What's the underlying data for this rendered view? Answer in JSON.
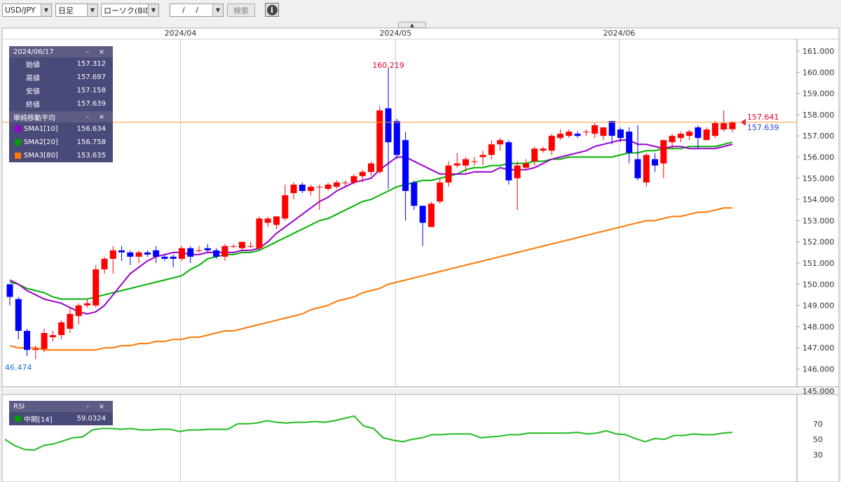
{
  "toolbar": {
    "pair": "USD/JPY",
    "timeframe": "日足",
    "chart_kind": "ローソク(BID)",
    "date": "/ /",
    "search": "検索",
    "info": "i"
  },
  "ohlc_panel": {
    "date": "2024/06/17",
    "rows": [
      {
        "label": "始値",
        "value": "157.312"
      },
      {
        "label": "高値",
        "value": "157.697"
      },
      {
        "label": "安値",
        "value": "157.158"
      },
      {
        "label": "終値",
        "value": "157.639"
      }
    ]
  },
  "sma_panel": {
    "title": "単純移動平均",
    "rows": [
      {
        "label": "SMA1[10]",
        "value": "156.634",
        "color": "#9900cc"
      },
      {
        "label": "SMA2[20]",
        "value": "156.758",
        "color": "#00a000"
      },
      {
        "label": "SMA3[80]",
        "value": "153.635",
        "color": "#ff7700"
      }
    ]
  },
  "rsi_panel": {
    "title": "RSI",
    "rows": [
      {
        "label": "中期[14]",
        "value": "59.0324",
        "color": "#00a000"
      }
    ]
  },
  "panel_buttons": {
    "minimize": "-",
    "close": "×"
  },
  "annotations": {
    "high_label": "160.219",
    "low_label": "46.474",
    "last_price": "157.641",
    "last_price2": "157.639"
  },
  "colors": {
    "up": "#ff0000",
    "down": "#0000ff",
    "sma1": "#9900cc",
    "sma2": "#00b000",
    "sma3": "#ff7700",
    "rsi": "#22bb22",
    "price_line": "#ff9933"
  },
  "chart_data": [
    {
      "type": "candlestick",
      "x_labels": [
        "2024/04",
        "2024/05",
        "2024/06"
      ],
      "ylim": [
        145.5,
        161.5
      ],
      "yticks": [
        "161.000",
        "160.000",
        "159.000",
        "158.000",
        "157.000",
        "156.000",
        "155.000",
        "154.000",
        "153.000",
        "152.000",
        "151.000",
        "150.000",
        "149.000",
        "148.000",
        "147.000",
        "146.000"
      ],
      "ohlc": [
        [
          150.0,
          150.0,
          149.0,
          149.4
        ],
        [
          149.3,
          149.4,
          147.4,
          147.8
        ],
        [
          147.8,
          147.9,
          146.6,
          146.9
        ],
        [
          146.9,
          147.1,
          146.47,
          146.95
        ],
        [
          146.95,
          147.9,
          146.8,
          147.7
        ],
        [
          147.5,
          147.8,
          147.3,
          147.6
        ],
        [
          147.6,
          148.3,
          147.4,
          148.2
        ],
        [
          147.9,
          148.9,
          147.7,
          148.6
        ],
        [
          148.5,
          149.1,
          148.1,
          149.0
        ],
        [
          149.0,
          149.3,
          148.9,
          149.1
        ],
        [
          149.0,
          150.9,
          148.9,
          150.7
        ],
        [
          150.7,
          151.3,
          150.5,
          151.2
        ],
        [
          151.2,
          151.8,
          150.5,
          151.6
        ],
        [
          151.6,
          151.8,
          151.1,
          151.5
        ],
        [
          151.5,
          151.6,
          150.9,
          151.3
        ],
        [
          151.3,
          151.6,
          151.0,
          151.5
        ],
        [
          151.5,
          151.6,
          151.3,
          151.4
        ],
        [
          151.6,
          151.8,
          151.0,
          151.3
        ],
        [
          151.3,
          151.4,
          151.1,
          151.2
        ],
        [
          151.3,
          151.4,
          150.8,
          151.2
        ],
        [
          151.2,
          151.8,
          151.1,
          151.7
        ],
        [
          151.7,
          151.8,
          151.0,
          151.3
        ],
        [
          151.6,
          151.8,
          151.5,
          151.6
        ],
        [
          151.7,
          151.9,
          151.5,
          151.6
        ],
        [
          151.6,
          151.7,
          151.2,
          151.3
        ],
        [
          151.3,
          151.9,
          151.1,
          151.8
        ],
        [
          151.8,
          151.9,
          151.7,
          151.8
        ],
        [
          151.7,
          152.0,
          151.6,
          152.0
        ],
        [
          151.8,
          152.0,
          151.7,
          151.8
        ],
        [
          151.7,
          153.2,
          151.6,
          153.1
        ],
        [
          152.9,
          153.2,
          152.7,
          153.1
        ],
        [
          152.8,
          153.2,
          152.6,
          153.2
        ],
        [
          153.1,
          154.7,
          153.0,
          154.2
        ],
        [
          154.3,
          154.8,
          154.0,
          154.7
        ],
        [
          154.7,
          154.8,
          154.3,
          154.4
        ],
        [
          154.4,
          154.7,
          154.2,
          154.6
        ],
        [
          154.6,
          154.7,
          153.5,
          154.6
        ],
        [
          154.5,
          154.8,
          154.4,
          154.7
        ],
        [
          154.6,
          154.9,
          154.5,
          154.8
        ],
        [
          154.8,
          154.9,
          154.6,
          154.8
        ],
        [
          154.8,
          155.2,
          154.7,
          155.1
        ],
        [
          155.1,
          155.4,
          154.8,
          155.3
        ],
        [
          155.3,
          155.8,
          155.1,
          155.7
        ],
        [
          155.3,
          158.4,
          155.2,
          158.2
        ],
        [
          158.3,
          160.2,
          154.5,
          156.7
        ],
        [
          157.7,
          157.8,
          155.9,
          156.1
        ],
        [
          156.8,
          157.2,
          153.0,
          154.4
        ],
        [
          154.8,
          154.9,
          153.5,
          153.7
        ],
        [
          153.7,
          153.7,
          151.8,
          152.9
        ],
        [
          152.7,
          153.9,
          152.7,
          153.8
        ],
        [
          153.9,
          155.0,
          153.8,
          154.8
        ],
        [
          154.8,
          155.8,
          154.6,
          155.6
        ],
        [
          155.6,
          156.2,
          155.5,
          155.7
        ],
        [
          155.6,
          156.0,
          155.3,
          155.9
        ],
        [
          155.8,
          156.0,
          155.6,
          155.8
        ],
        [
          156.0,
          156.3,
          155.6,
          156.1
        ],
        [
          156.1,
          156.8,
          155.9,
          156.6
        ],
        [
          156.6,
          156.9,
          156.3,
          156.8
        ],
        [
          156.7,
          156.8,
          154.7,
          154.9
        ],
        [
          155.0,
          155.8,
          153.5,
          155.6
        ],
        [
          155.5,
          155.9,
          155.4,
          155.7
        ],
        [
          155.8,
          156.5,
          155.6,
          156.4
        ],
        [
          156.3,
          156.5,
          156.2,
          156.4
        ],
        [
          156.3,
          157.1,
          156.1,
          157.0
        ],
        [
          156.9,
          157.3,
          156.8,
          157.1
        ],
        [
          157.0,
          157.3,
          156.9,
          157.2
        ],
        [
          157.1,
          157.2,
          156.9,
          157.0
        ],
        [
          157.2,
          157.3,
          157.0,
          157.2
        ],
        [
          157.1,
          157.6,
          156.9,
          157.5
        ],
        [
          157.0,
          157.3,
          156.8,
          157.4
        ],
        [
          157.7,
          157.7,
          156.6,
          157.0
        ],
        [
          157.3,
          157.4,
          156.7,
          156.9
        ],
        [
          157.2,
          157.4,
          155.7,
          156.2
        ],
        [
          155.9,
          157.5,
          154.9,
          155.0
        ],
        [
          154.8,
          156.2,
          154.6,
          156.1
        ],
        [
          155.9,
          156.2,
          155.3,
          155.6
        ],
        [
          155.7,
          156.8,
          155.0,
          156.8
        ],
        [
          156.7,
          157.1,
          156.4,
          157.0
        ],
        [
          156.9,
          157.2,
          156.7,
          157.1
        ],
        [
          157.0,
          157.3,
          156.8,
          157.2
        ],
        [
          157.4,
          157.5,
          156.4,
          156.9
        ],
        [
          156.8,
          157.4,
          156.8,
          157.3
        ],
        [
          157.0,
          157.7,
          156.9,
          157.6
        ],
        [
          157.3,
          158.2,
          157.2,
          157.6
        ],
        [
          157.312,
          157.697,
          157.158,
          157.639
        ]
      ],
      "sma1_10": [
        150.2,
        150.0,
        149.7,
        149.5,
        149.3,
        149.2,
        149.1,
        148.9,
        148.7,
        148.6,
        148.7,
        149.0,
        149.5,
        150.0,
        150.5,
        150.8,
        151.1,
        151.3,
        151.4,
        151.5,
        151.5,
        151.4,
        151.4,
        151.5,
        151.5,
        151.5,
        151.5,
        151.6,
        151.6,
        151.7,
        152.0,
        152.4,
        152.7,
        153.0,
        153.3,
        153.6,
        153.9,
        154.1,
        154.4,
        154.6,
        154.8,
        154.9,
        155.0,
        155.4,
        155.7,
        156.0,
        156.0,
        155.8,
        155.6,
        155.4,
        155.2,
        155.2,
        155.2,
        155.2,
        155.3,
        155.3,
        155.3,
        155.5,
        155.4,
        155.4,
        155.4,
        155.5,
        155.7,
        155.9,
        156.0,
        156.1,
        156.2,
        156.3,
        156.5,
        156.6,
        156.7,
        156.8,
        156.8,
        156.6,
        156.6,
        156.5,
        156.4,
        156.5,
        156.5,
        156.4,
        156.4,
        156.4,
        156.4,
        156.5,
        156.6
      ],
      "sma2_20": [
        150.1,
        150.0,
        149.8,
        149.7,
        149.6,
        149.4,
        149.3,
        149.3,
        149.3,
        149.3,
        149.4,
        149.5,
        149.6,
        149.7,
        149.8,
        149.9,
        150.0,
        150.1,
        150.2,
        150.3,
        150.4,
        150.7,
        150.9,
        151.2,
        151.3,
        151.4,
        151.4,
        151.5,
        151.5,
        151.6,
        151.8,
        152.0,
        152.2,
        152.4,
        152.6,
        152.8,
        153.0,
        153.1,
        153.3,
        153.5,
        153.7,
        153.9,
        154.0,
        154.2,
        154.4,
        154.6,
        154.7,
        154.8,
        154.9,
        154.9,
        155.0,
        155.1,
        155.2,
        155.4,
        155.5,
        155.5,
        155.6,
        155.6,
        155.7,
        155.7,
        155.7,
        155.8,
        155.8,
        155.9,
        155.9,
        156.0,
        156.0,
        156.0,
        156.0,
        156.0,
        156.0,
        156.1,
        156.2,
        156.2,
        156.3,
        156.3,
        156.4,
        156.4,
        156.4,
        156.5,
        156.5,
        156.5,
        156.5,
        156.6,
        156.7
      ],
      "sma3_80": [
        147.1,
        147.0,
        147.0,
        147.0,
        146.9,
        146.9,
        146.9,
        146.9,
        146.9,
        146.9,
        146.9,
        147.0,
        147.0,
        147.1,
        147.1,
        147.2,
        147.2,
        147.3,
        147.3,
        147.4,
        147.4,
        147.5,
        147.5,
        147.6,
        147.7,
        147.8,
        147.8,
        147.9,
        148.0,
        148.1,
        148.2,
        148.3,
        148.4,
        148.5,
        148.6,
        148.8,
        148.9,
        149.0,
        149.2,
        149.3,
        149.4,
        149.6,
        149.7,
        149.8,
        150.0,
        150.1,
        150.2,
        150.3,
        150.4,
        150.5,
        150.6,
        150.7,
        150.8,
        150.9,
        151.0,
        151.1,
        151.2,
        151.3,
        151.4,
        151.5,
        151.6,
        151.7,
        151.8,
        151.9,
        152.0,
        152.1,
        152.2,
        152.3,
        152.4,
        152.5,
        152.6,
        152.7,
        152.8,
        152.9,
        153.0,
        153.0,
        153.1,
        153.2,
        153.2,
        153.3,
        153.4,
        153.4,
        153.5,
        153.6,
        153.6
      ],
      "highlight": {
        "value": 157.641
      },
      "axis_extra": "145.000"
    },
    {
      "type": "line",
      "title": "RSI",
      "ylim": [
        10,
        100
      ],
      "yticks": [
        "70",
        "50",
        "30"
      ],
      "values": [
        50,
        42,
        37,
        36,
        42,
        44,
        48,
        52,
        53,
        62,
        64,
        64,
        63,
        64,
        62,
        62,
        63,
        63,
        60,
        62,
        62,
        63,
        63,
        63,
        70,
        70,
        71,
        74,
        72,
        71,
        72,
        72,
        73,
        72,
        74,
        77,
        80,
        67,
        64,
        52,
        49,
        47,
        50,
        52,
        56,
        56,
        57,
        57,
        57,
        52,
        53,
        54,
        56,
        56,
        58,
        58,
        58,
        58,
        58,
        59,
        57,
        58,
        61,
        57,
        56,
        51,
        47,
        51,
        50,
        55,
        55,
        57,
        56,
        56,
        58,
        59
      ]
    }
  ]
}
